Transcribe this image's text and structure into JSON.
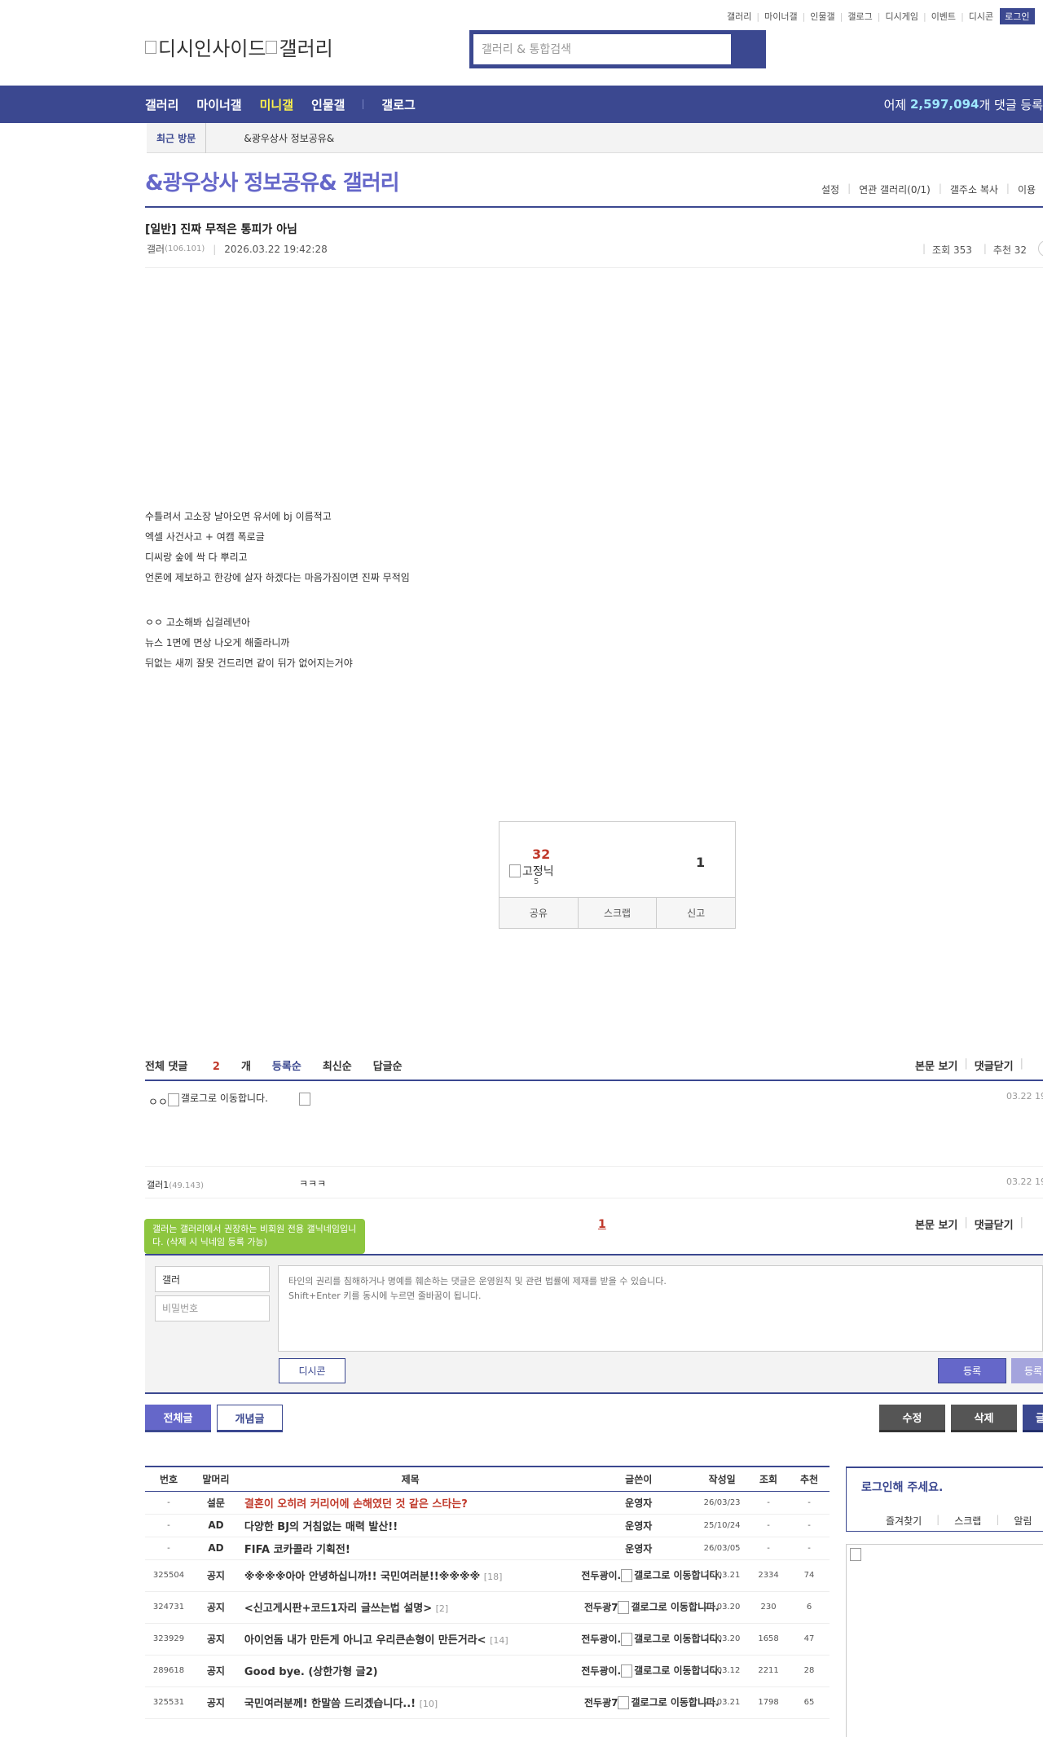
{
  "top_links": [
    "갤러리",
    "마이너갤",
    "인물갤",
    "갤로그",
    "디시게임",
    "이벤트",
    "디시콘"
  ],
  "top_login": "로그인",
  "logo": {
    "alt1": "디시인사이드",
    "alt2": "갤러리"
  },
  "search": {
    "placeholder": "갤러리 & 통합검색"
  },
  "nav": {
    "items": [
      "갤러리",
      "마이너갤",
      "미니갤",
      "인물갤",
      "갤로그"
    ],
    "active_index": 2,
    "stat_prefix": "어제 ",
    "stat_value": "2,597,094",
    "stat_suffix": "개 댓글 등록"
  },
  "visited": {
    "label": "최근 방문",
    "item": "&광우상사 정보공유&"
  },
  "gallery": {
    "title": "&광우상사 정보공유& 갤러리",
    "links": [
      "설정",
      "연관 갤러리(0/1)",
      "갤주소 복사",
      "이용"
    ]
  },
  "post": {
    "title": "[일반] 진짜 무적은 통피가 아님",
    "writer": "갤러",
    "writer_ip": "(106.101)",
    "date": "2026.03.22 19:42:28",
    "views": "조회 353",
    "recommends": "추천 32",
    "body_lines_1": [
      "수틀려서 고소장 날아오면 유서에 bj 이름적고",
      "엑셀 사건사고 + 여캠 폭로글",
      "디씨랑 숲에 싹 다 뿌리고",
      "언론에 제보하고 한강에 살자 하겠다는 마음가짐이면 진짜 무적임"
    ],
    "body_lines_2": [
      "ㅇㅇ 고소해봐 십걸레년아",
      "뉴스 1면에 면상 나오게 해줄라니까",
      "뒤없는 새끼 잘못 건드리면 같이 뒤가 없어지는거야"
    ]
  },
  "recommend": {
    "up": "32",
    "fix_nick_alt": "고정닉",
    "fix_count": "5",
    "down": "1",
    "buttons": [
      "공유",
      "스크랩",
      "신고"
    ]
  },
  "comments": {
    "total_label": "전체 댓글 ",
    "total_count": "2",
    "total_unit": "개",
    "sorts": [
      "등록순",
      "최신순",
      "답글순"
    ],
    "right_links": [
      "본문 보기",
      "댓글닫기"
    ],
    "items": [
      {
        "nick": "ㅇㅇ",
        "gallog_alt": "갤로그로 이동합니다.",
        "date": "03.22 19"
      },
      {
        "nick": "갤러1",
        "ip": "(49.143)",
        "text": "ㅋㅋㅋ",
        "date": "03.22 19"
      }
    ],
    "page": "1",
    "tooltip": "갤러는 갤러리에서 권장하는 비회원 전용 갤닉네임입니다. (삭제 시 닉네임 등록 가능)"
  },
  "write": {
    "nick_value": "갤러",
    "pw_placeholder": "비밀번호",
    "text_placeholder": "타인의 권리를 침해하거나 명예를 훼손하는 댓글은 운영원칙 및 관련 법률에 제재를 받을 수 있습니다.\nShift+Enter 키를 동시에 누르면 줄바꿈이 됩니다.",
    "dccon": "디시콘",
    "submit": "등록",
    "submit2": "등록"
  },
  "buttons": {
    "all": "전체글",
    "concept": "개념글",
    "edit": "수정",
    "delete": "삭제",
    "write": "글"
  },
  "list": {
    "headers": [
      "번호",
      "말머리",
      "제목",
      "글쓴이",
      "작성일",
      "조회",
      "추천"
    ],
    "rows": [
      {
        "num": "-",
        "head": "설문",
        "subject": "결혼이 오히려 커리어에 손해였던 것 같은 스타는?",
        "red": true,
        "reply": "",
        "writer": "운영자",
        "gcon": "",
        "date": "26/03/23",
        "views": "-",
        "rec": "-"
      },
      {
        "num": "-",
        "head": "AD",
        "subject": "다양한 BJ의 거침없는 매력 발산!!",
        "red": false,
        "reply": "",
        "writer": "운영자",
        "gcon": "",
        "date": "25/10/24",
        "views": "-",
        "rec": "-"
      },
      {
        "num": "-",
        "head": "AD",
        "subject": "FIFA 코카콜라 기획전!",
        "red": false,
        "reply": "",
        "writer": "운영자",
        "gcon": "",
        "date": "26/03/05",
        "views": "-",
        "rec": "-"
      },
      {
        "num": "325504",
        "head": "공지",
        "subject": "※※※※아아 안녕하십니까!! 국민여러분!!※※※※",
        "red": false,
        "reply": "[18]",
        "writer": "전두광이.",
        "gcon": "갤로그로 이동합니다.",
        "date": "26.03.21",
        "views": "2334",
        "rec": "74"
      },
      {
        "num": "324731",
        "head": "공지",
        "subject": "<신고게시판+코드1자리 글쓰는법 설명>",
        "red": false,
        "reply": "[2]",
        "writer": "전두광7",
        "gcon": "갤로그로 이동합니다.",
        "date": "26.03.20",
        "views": "230",
        "rec": "6"
      },
      {
        "num": "323929",
        "head": "공지",
        "subject": "아이언돔 내가 만든게 아니고 우리큰손형이 만든거라<",
        "red": false,
        "reply": "[14]",
        "writer": "전두광이.",
        "gcon": "갤로그로 이동합니다.",
        "date": "26.03.20",
        "views": "1658",
        "rec": "47"
      },
      {
        "num": "289618",
        "head": "공지",
        "subject": "Good bye. (상한가형 글2)",
        "red": false,
        "reply": "",
        "writer": "전두광이.",
        "gcon": "갤로그로 이동합니다.",
        "date": "26.03.12",
        "views": "2211",
        "rec": "28"
      },
      {
        "num": "325531",
        "head": "공지",
        "subject": "국민여러분께! 한말씀 드리겠습니다..!",
        "red": false,
        "reply": "[10]",
        "writer": "전두광7",
        "gcon": "갤로그로 이동합니다.",
        "date": "26.03.21",
        "views": "1798",
        "rec": "65"
      }
    ]
  },
  "side": {
    "login_title": "로그인해 주세요.",
    "links": [
      "즐겨찾기",
      "스크랩",
      "알림"
    ]
  }
}
